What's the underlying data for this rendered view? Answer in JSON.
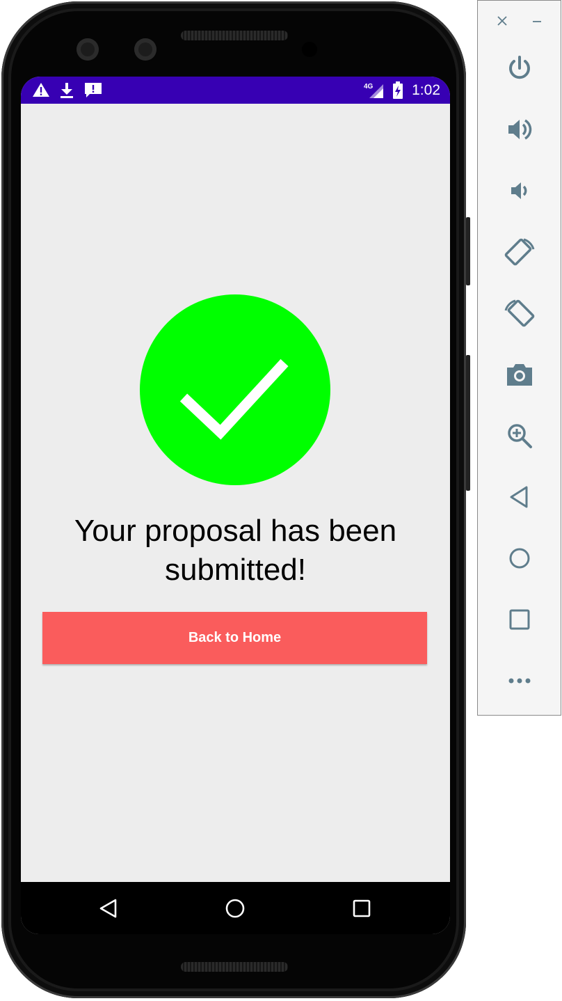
{
  "status_bar": {
    "time": "1:02",
    "network_label": "4G",
    "icons": [
      "warning-icon",
      "download-icon",
      "feedback-icon",
      "signal-4g-icon",
      "battery-charging-icon"
    ]
  },
  "success": {
    "icon": "checkmark-icon",
    "icon_color": "#00ff00",
    "message_line1": "Your proposal has been",
    "message_line2": "submitted!"
  },
  "back_home_button": {
    "label": "Back to Home",
    "color": "#fa5c5c"
  },
  "navigation_bar": {
    "buttons": [
      "back-triangle-icon",
      "home-circle-icon",
      "recents-square-icon"
    ]
  },
  "emulator_panel": {
    "top_controls": [
      "close-icon",
      "minimize-icon"
    ],
    "buttons": [
      "power-icon",
      "volume-up-icon",
      "volume-down-icon",
      "rotate-left-icon",
      "rotate-right-icon",
      "camera-icon",
      "zoom-icon",
      "back-icon",
      "home-icon",
      "overview-icon",
      "more-icon"
    ]
  },
  "colors": {
    "status_bar": "#3700b3",
    "screen_background": "#ededed",
    "panel_icon": "#5f7d8c"
  }
}
